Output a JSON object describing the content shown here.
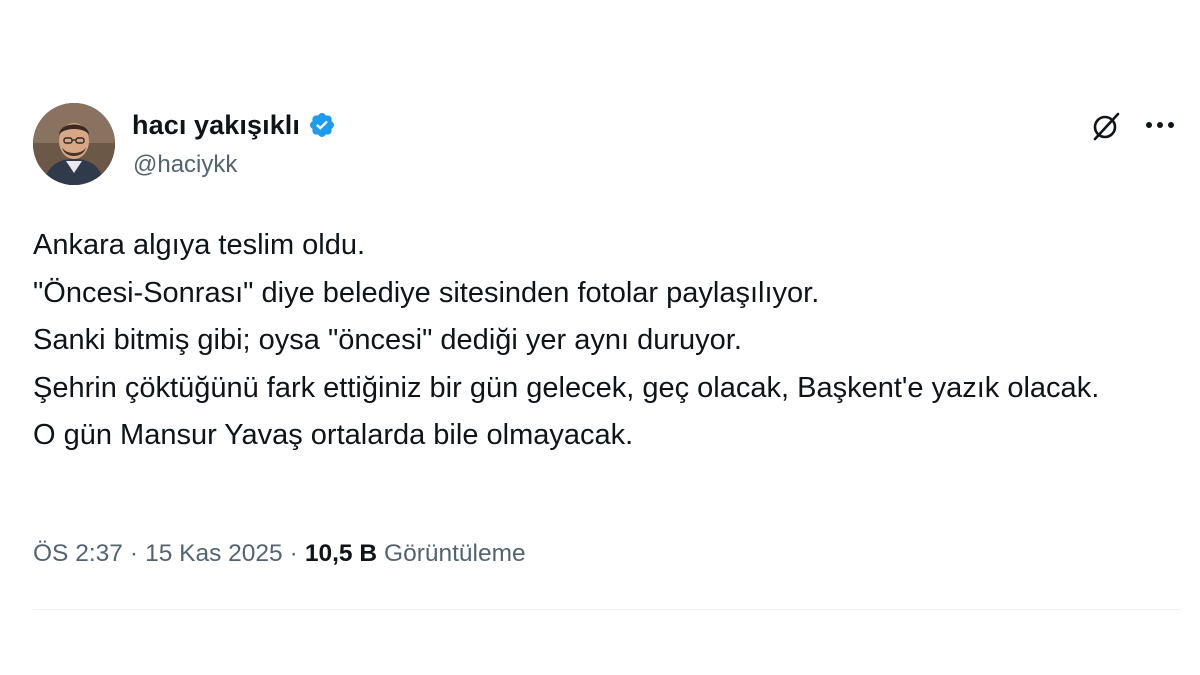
{
  "author": {
    "display_name": "hacı yakışıklı",
    "handle": "@haciykk",
    "verified": true,
    "verified_color": "#1d9bf0",
    "avatar_icon": "profile-photo"
  },
  "actions": {
    "grok_icon": "grok-icon",
    "more_icon": "more-options-icon"
  },
  "tweet": {
    "lines": [
      "Ankara algıya teslim oldu.",
      "\"Öncesi-Sonrası\" diye belediye sitesinden fotolar paylaşılıyor.",
      "Sanki bitmiş gibi; oysa \"öncesi\" dediği yer aynı duruyor.",
      "Şehrin çöktüğünü fark ettiğiniz bir gün gelecek, geç olacak, Başkent'e yazık olacak.",
      "O gün Mansur Yavaş ortalarda bile olmayacak."
    ]
  },
  "meta": {
    "time": "ÖS 2:37",
    "separator": "·",
    "date": "15 Kas 2025",
    "views_count": "10,5 B",
    "views_label": "Görüntüleme"
  },
  "colors": {
    "text_primary": "#0f1419",
    "text_secondary": "#536471",
    "divider": "#eff3f4"
  }
}
